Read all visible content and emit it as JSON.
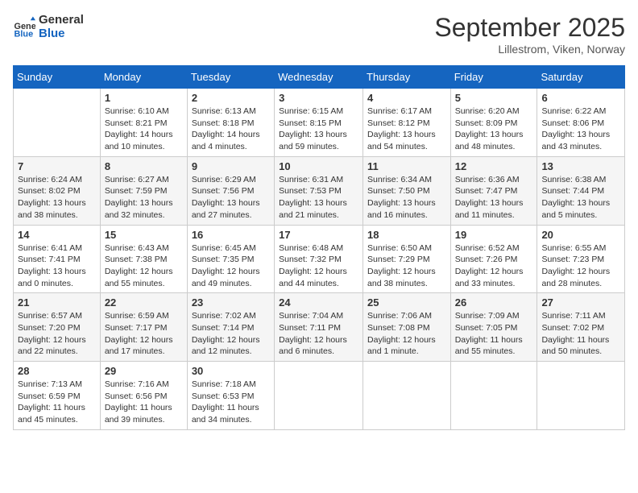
{
  "header": {
    "logo_line1": "General",
    "logo_line2": "Blue",
    "month": "September 2025",
    "location": "Lillestrom, Viken, Norway"
  },
  "days_of_week": [
    "Sunday",
    "Monday",
    "Tuesday",
    "Wednesday",
    "Thursday",
    "Friday",
    "Saturday"
  ],
  "weeks": [
    [
      {
        "day": "",
        "sunrise": "",
        "sunset": "",
        "daylight": ""
      },
      {
        "day": "1",
        "sunrise": "Sunrise: 6:10 AM",
        "sunset": "Sunset: 8:21 PM",
        "daylight": "Daylight: 14 hours and 10 minutes."
      },
      {
        "day": "2",
        "sunrise": "Sunrise: 6:13 AM",
        "sunset": "Sunset: 8:18 PM",
        "daylight": "Daylight: 14 hours and 4 minutes."
      },
      {
        "day": "3",
        "sunrise": "Sunrise: 6:15 AM",
        "sunset": "Sunset: 8:15 PM",
        "daylight": "Daylight: 13 hours and 59 minutes."
      },
      {
        "day": "4",
        "sunrise": "Sunrise: 6:17 AM",
        "sunset": "Sunset: 8:12 PM",
        "daylight": "Daylight: 13 hours and 54 minutes."
      },
      {
        "day": "5",
        "sunrise": "Sunrise: 6:20 AM",
        "sunset": "Sunset: 8:09 PM",
        "daylight": "Daylight: 13 hours and 48 minutes."
      },
      {
        "day": "6",
        "sunrise": "Sunrise: 6:22 AM",
        "sunset": "Sunset: 8:06 PM",
        "daylight": "Daylight: 13 hours and 43 minutes."
      }
    ],
    [
      {
        "day": "7",
        "sunrise": "Sunrise: 6:24 AM",
        "sunset": "Sunset: 8:02 PM",
        "daylight": "Daylight: 13 hours and 38 minutes."
      },
      {
        "day": "8",
        "sunrise": "Sunrise: 6:27 AM",
        "sunset": "Sunset: 7:59 PM",
        "daylight": "Daylight: 13 hours and 32 minutes."
      },
      {
        "day": "9",
        "sunrise": "Sunrise: 6:29 AM",
        "sunset": "Sunset: 7:56 PM",
        "daylight": "Daylight: 13 hours and 27 minutes."
      },
      {
        "day": "10",
        "sunrise": "Sunrise: 6:31 AM",
        "sunset": "Sunset: 7:53 PM",
        "daylight": "Daylight: 13 hours and 21 minutes."
      },
      {
        "day": "11",
        "sunrise": "Sunrise: 6:34 AM",
        "sunset": "Sunset: 7:50 PM",
        "daylight": "Daylight: 13 hours and 16 minutes."
      },
      {
        "day": "12",
        "sunrise": "Sunrise: 6:36 AM",
        "sunset": "Sunset: 7:47 PM",
        "daylight": "Daylight: 13 hours and 11 minutes."
      },
      {
        "day": "13",
        "sunrise": "Sunrise: 6:38 AM",
        "sunset": "Sunset: 7:44 PM",
        "daylight": "Daylight: 13 hours and 5 minutes."
      }
    ],
    [
      {
        "day": "14",
        "sunrise": "Sunrise: 6:41 AM",
        "sunset": "Sunset: 7:41 PM",
        "daylight": "Daylight: 13 hours and 0 minutes."
      },
      {
        "day": "15",
        "sunrise": "Sunrise: 6:43 AM",
        "sunset": "Sunset: 7:38 PM",
        "daylight": "Daylight: 12 hours and 55 minutes."
      },
      {
        "day": "16",
        "sunrise": "Sunrise: 6:45 AM",
        "sunset": "Sunset: 7:35 PM",
        "daylight": "Daylight: 12 hours and 49 minutes."
      },
      {
        "day": "17",
        "sunrise": "Sunrise: 6:48 AM",
        "sunset": "Sunset: 7:32 PM",
        "daylight": "Daylight: 12 hours and 44 minutes."
      },
      {
        "day": "18",
        "sunrise": "Sunrise: 6:50 AM",
        "sunset": "Sunset: 7:29 PM",
        "daylight": "Daylight: 12 hours and 38 minutes."
      },
      {
        "day": "19",
        "sunrise": "Sunrise: 6:52 AM",
        "sunset": "Sunset: 7:26 PM",
        "daylight": "Daylight: 12 hours and 33 minutes."
      },
      {
        "day": "20",
        "sunrise": "Sunrise: 6:55 AM",
        "sunset": "Sunset: 7:23 PM",
        "daylight": "Daylight: 12 hours and 28 minutes."
      }
    ],
    [
      {
        "day": "21",
        "sunrise": "Sunrise: 6:57 AM",
        "sunset": "Sunset: 7:20 PM",
        "daylight": "Daylight: 12 hours and 22 minutes."
      },
      {
        "day": "22",
        "sunrise": "Sunrise: 6:59 AM",
        "sunset": "Sunset: 7:17 PM",
        "daylight": "Daylight: 12 hours and 17 minutes."
      },
      {
        "day": "23",
        "sunrise": "Sunrise: 7:02 AM",
        "sunset": "Sunset: 7:14 PM",
        "daylight": "Daylight: 12 hours and 12 minutes."
      },
      {
        "day": "24",
        "sunrise": "Sunrise: 7:04 AM",
        "sunset": "Sunset: 7:11 PM",
        "daylight": "Daylight: 12 hours and 6 minutes."
      },
      {
        "day": "25",
        "sunrise": "Sunrise: 7:06 AM",
        "sunset": "Sunset: 7:08 PM",
        "daylight": "Daylight: 12 hours and 1 minute."
      },
      {
        "day": "26",
        "sunrise": "Sunrise: 7:09 AM",
        "sunset": "Sunset: 7:05 PM",
        "daylight": "Daylight: 11 hours and 55 minutes."
      },
      {
        "day": "27",
        "sunrise": "Sunrise: 7:11 AM",
        "sunset": "Sunset: 7:02 PM",
        "daylight": "Daylight: 11 hours and 50 minutes."
      }
    ],
    [
      {
        "day": "28",
        "sunrise": "Sunrise: 7:13 AM",
        "sunset": "Sunset: 6:59 PM",
        "daylight": "Daylight: 11 hours and 45 minutes."
      },
      {
        "day": "29",
        "sunrise": "Sunrise: 7:16 AM",
        "sunset": "Sunset: 6:56 PM",
        "daylight": "Daylight: 11 hours and 39 minutes."
      },
      {
        "day": "30",
        "sunrise": "Sunrise: 7:18 AM",
        "sunset": "Sunset: 6:53 PM",
        "daylight": "Daylight: 11 hours and 34 minutes."
      },
      {
        "day": "",
        "sunrise": "",
        "sunset": "",
        "daylight": ""
      },
      {
        "day": "",
        "sunrise": "",
        "sunset": "",
        "daylight": ""
      },
      {
        "day": "",
        "sunrise": "",
        "sunset": "",
        "daylight": ""
      },
      {
        "day": "",
        "sunrise": "",
        "sunset": "",
        "daylight": ""
      }
    ]
  ]
}
